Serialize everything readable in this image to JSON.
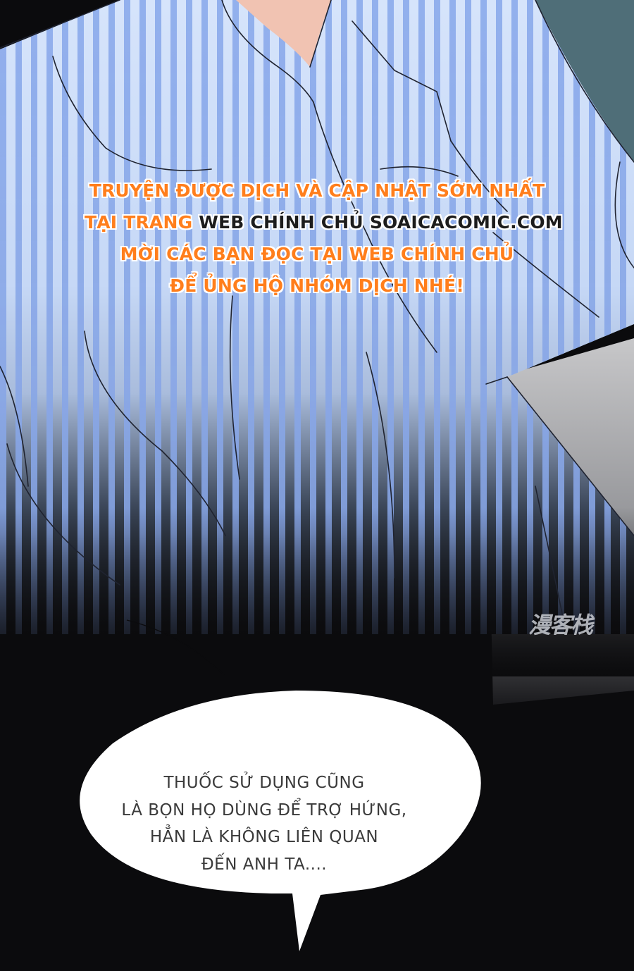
{
  "credit": {
    "line1": "TRUYỆN ĐƯỢC DỊCH VÀ CẬP NHẬT SỚM NHẤT",
    "line2_prefix": "TẠI TRANG ",
    "line2_highlight": "WEB CHÍNH CHỦ SOAICACOMIC.COM",
    "line3": "MỜI CÁC BẠN ĐỌC TẠI WEB CHÍNH CHỦ",
    "line4": "ĐỂ ỦNG HỘ NHÓM DỊCH NHÉ!"
  },
  "watermark": {
    "text": "漫客栈"
  },
  "bubble": {
    "lines": [
      "THUỐC SỬ DỤNG CŨNG",
      "LÀ BỌN HỌ DÙNG ĐỂ TRỢ HỨNG,",
      "HẲN LÀ KHÔNG LIÊN QUAN",
      "ĐẾN ANH TA...."
    ]
  },
  "colors": {
    "shirt_light": "#c9dcf8",
    "shirt_stripe": "#8eadec",
    "background_dark": "#0b0b0d",
    "credit_orange": "#ff7e1c",
    "bubble_fill": "#ffffff"
  }
}
